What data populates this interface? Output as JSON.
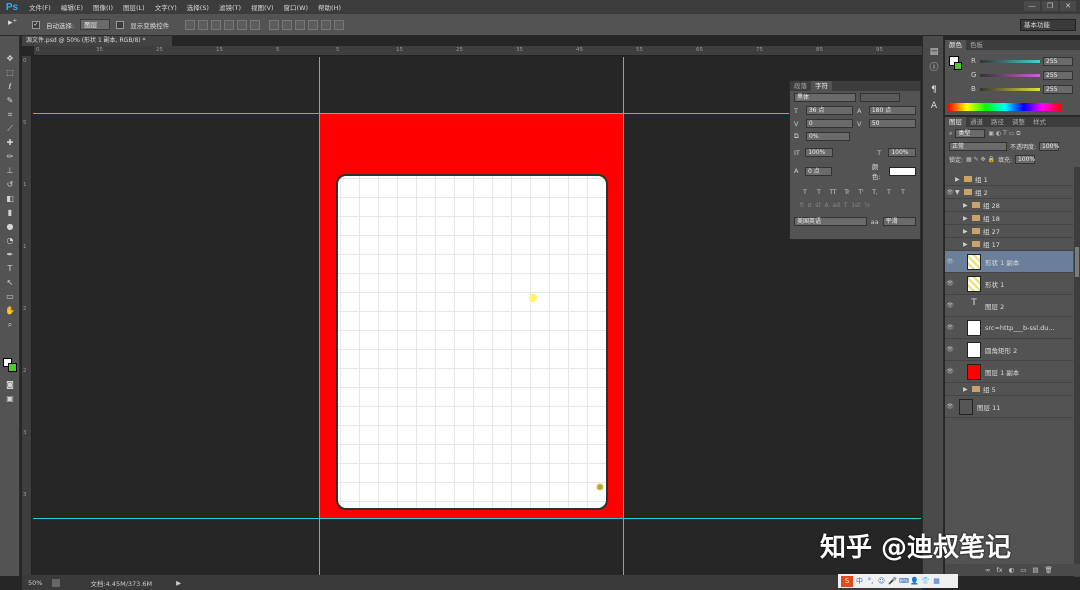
{
  "app": {
    "logo": "Ps"
  },
  "menu": [
    "文件(F)",
    "编辑(E)",
    "图像(I)",
    "图层(L)",
    "文字(Y)",
    "选择(S)",
    "滤镜(T)",
    "视图(V)",
    "窗口(W)",
    "帮助(H)"
  ],
  "window_buttons": [
    "—",
    "❐",
    "✕"
  ],
  "options": {
    "auto_select_label": "自动选择:",
    "auto_select_value": "图层",
    "show_transform_label": "显示变换控件",
    "workspace": "基本功能"
  },
  "document": {
    "tab_title": "源文件.psd @ 50% (形状 1 副本, RGB/8) *",
    "zoom": "50%",
    "doc_size": "文档:4.45M/373.6M"
  },
  "ruler_h": [
    "0",
    "35",
    "25",
    "15",
    "5",
    "5",
    "15",
    "25",
    "35",
    "45",
    "55",
    "65",
    "75",
    "85",
    "95"
  ],
  "ruler_v": [
    "0",
    "5",
    "1",
    "1",
    "2",
    "2",
    "3",
    "3"
  ],
  "character_panel": {
    "tabs": [
      "段落",
      "字符"
    ],
    "font_family": "黑体",
    "font_size": "36 点",
    "leading": "180 点",
    "kerning": "0",
    "tracking": "50",
    "scale_pct": "0%",
    "vscale": "100%",
    "hscale": "100%",
    "baseline": "0 点",
    "color_label": "颜色:",
    "language": "美国英语",
    "antialias_label": "aa",
    "antialias": "平滑",
    "style_buttons": [
      "T",
      "T",
      "TT",
      "Tr",
      "T'",
      "T,",
      "T",
      "T"
    ]
  },
  "color_panel": {
    "tabs": [
      "颜色",
      "色板"
    ],
    "channels": [
      {
        "label": "R",
        "value": "255",
        "color": "#44d0d8"
      },
      {
        "label": "G",
        "value": "255",
        "color": "#d060d8"
      },
      {
        "label": "B",
        "value": "255",
        "color": "#e8e040"
      }
    ]
  },
  "layers_panel": {
    "tabs": [
      "图层",
      "通道",
      "路径",
      "调整",
      "样式"
    ],
    "filter_kind": "类型",
    "blend_mode": "正常",
    "opacity_label": "不透明度:",
    "opacity": "100%",
    "lock_label": "锁定:",
    "fill_label": "填充:",
    "fill": "100%",
    "layers": [
      {
        "name": "组 1",
        "type": "group",
        "eye": "",
        "depth": 0,
        "arrow": "▶"
      },
      {
        "name": "组 2",
        "type": "group",
        "eye": "👁",
        "depth": 0,
        "arrow": "▼"
      },
      {
        "name": "组 28",
        "type": "group",
        "eye": "",
        "depth": 1,
        "arrow": "▶"
      },
      {
        "name": "组 18",
        "type": "group",
        "eye": "",
        "depth": 1,
        "arrow": "▶"
      },
      {
        "name": "组 27",
        "type": "group",
        "eye": "",
        "depth": 1,
        "arrow": "▶"
      },
      {
        "name": "组 17",
        "type": "group",
        "eye": "",
        "depth": 1,
        "arrow": "▶"
      },
      {
        "name": "形状 1 副本",
        "type": "shape",
        "eye": "👁",
        "depth": 1,
        "selected": true
      },
      {
        "name": "形状 1",
        "type": "shape",
        "eye": "👁",
        "depth": 1
      },
      {
        "name": "图层 2",
        "type": "text",
        "eye": "👁",
        "depth": 1
      },
      {
        "name": "src=http___b-ssl.du...",
        "type": "image",
        "eye": "👁",
        "depth": 1
      },
      {
        "name": "圆角矩形 2",
        "type": "shape-white",
        "eye": "👁",
        "depth": 1
      },
      {
        "name": "图层 1 副本",
        "type": "red",
        "eye": "👁",
        "depth": 1
      },
      {
        "name": "组 5",
        "type": "group",
        "eye": "",
        "depth": 1,
        "arrow": "▶"
      },
      {
        "name": "图层 11",
        "type": "gray",
        "eye": "👁",
        "depth": 0
      }
    ],
    "footer_icons": [
      "∞",
      "fx",
      "◐",
      "▭",
      "▤",
      "🗑"
    ]
  },
  "taskbar": {
    "ime_label": "中",
    "icons": [
      "°,",
      "☺",
      "🎤",
      "⌨",
      "👤",
      "👕",
      "▦"
    ]
  },
  "watermark": "知乎 @迪叔笔记",
  "colors": {
    "canvas_red": "#ff0000",
    "guide": "#2ec9d6",
    "panel": "#535353",
    "selected_layer": "#6b7f9a"
  }
}
